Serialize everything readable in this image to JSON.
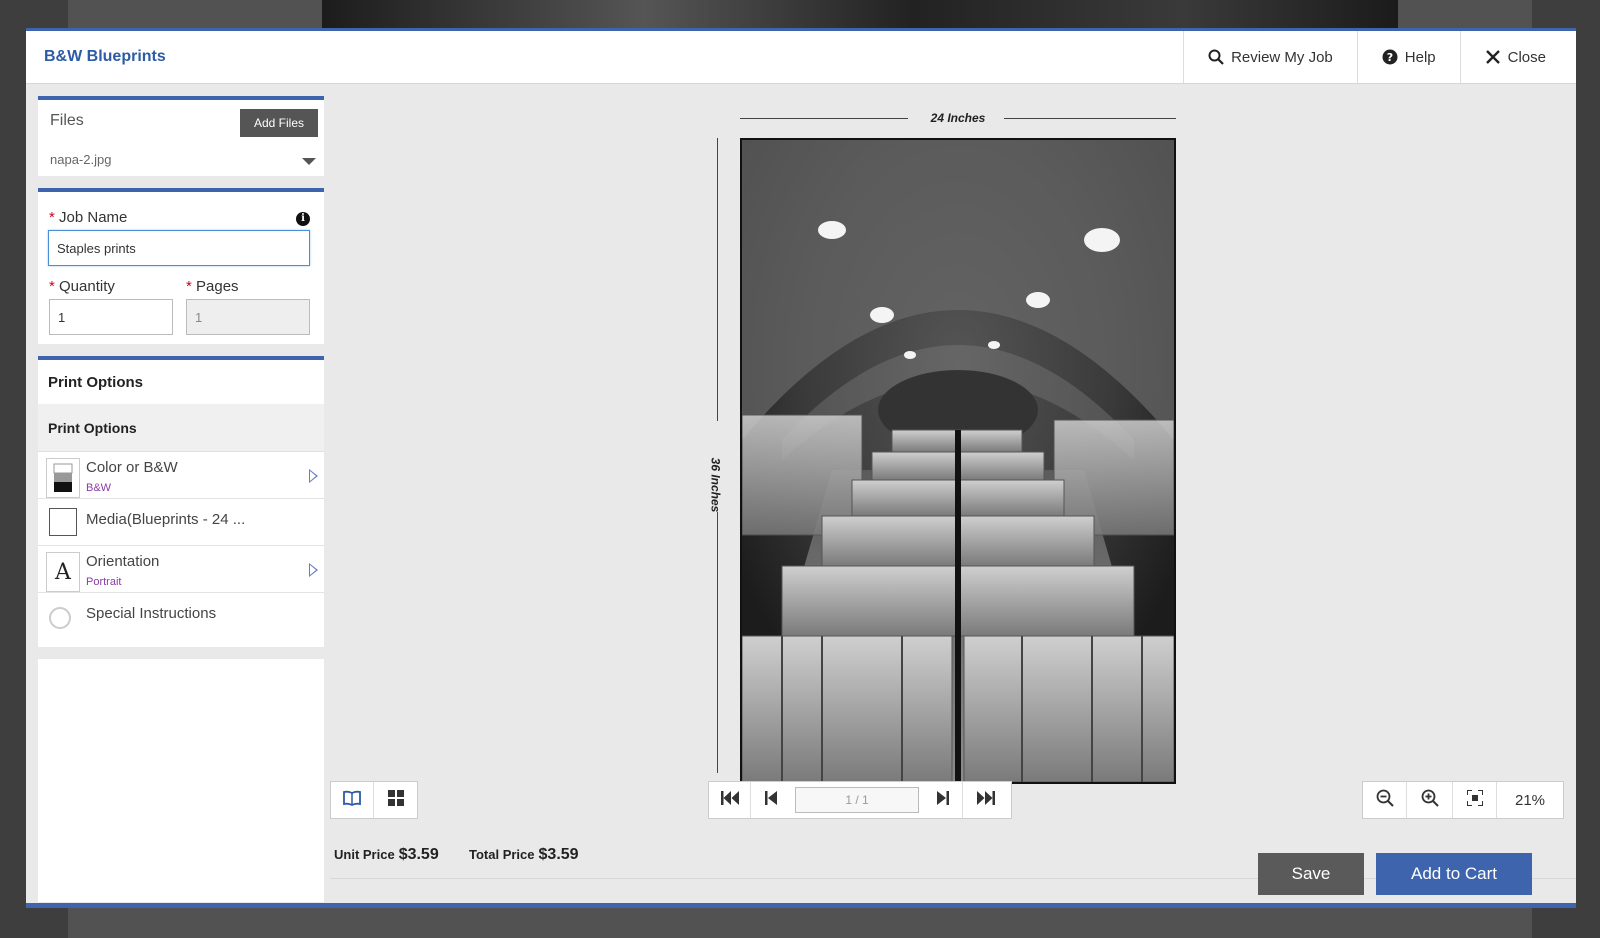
{
  "header": {
    "brand": "B&W Blueprints",
    "review_label": "Review My Job",
    "help_label": "Help",
    "close_label": "Close"
  },
  "files": {
    "label": "Files",
    "add_files_label": "Add Files",
    "selected_file": "napa-2.jpg"
  },
  "job": {
    "job_name_label": "Job Name",
    "job_name_value": "Staples prints",
    "quantity_label": "Quantity",
    "quantity_value": "1",
    "pages_label": "Pages",
    "pages_value": "1",
    "required_mark": "*"
  },
  "print_options": {
    "title": "Print Options",
    "subtitle": "Print Options",
    "items": [
      {
        "name": "Color or B&W",
        "value": "B&W"
      },
      {
        "name": "Media(Blueprints - 24 ...",
        "value": ""
      },
      {
        "name": "Orientation",
        "value": "Portrait"
      },
      {
        "name": "Special Instructions",
        "value": ""
      }
    ],
    "orientation_glyph": "A"
  },
  "preview": {
    "width_label": "24 Inches",
    "height_label": "36 Inches",
    "page_indicator": "1 / 1",
    "zoom": "21%"
  },
  "pricing": {
    "unit_label": "Unit Price",
    "unit_value": "$3.59",
    "total_label": "Total Price",
    "total_value": "$3.59"
  },
  "actions": {
    "save_label": "Save",
    "add_to_cart_label": "Add to Cart"
  },
  "colors": {
    "accent": "#3d64ad",
    "option_value": "#8a3aa8"
  }
}
